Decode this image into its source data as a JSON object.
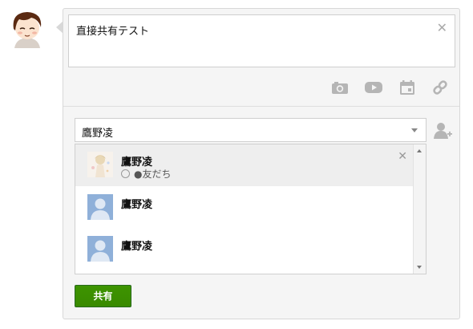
{
  "post": {
    "text": "直接共有テスト"
  },
  "recipients": {
    "value": "鷹野凌"
  },
  "suggestions": [
    {
      "name": "鷹野凌",
      "sub": "●友だち"
    },
    {
      "name": "鷹野凌"
    },
    {
      "name": "鷹野凌"
    }
  ],
  "share_button": "共有",
  "icons": {
    "photo": "camera-icon",
    "video": "video-icon",
    "event": "calendar-icon",
    "link": "link-icon",
    "add_person": "add-person-icon",
    "close": "close-icon"
  },
  "colors": {
    "share_button": "#3d9400",
    "default_avatar": "#8fb0d9"
  }
}
